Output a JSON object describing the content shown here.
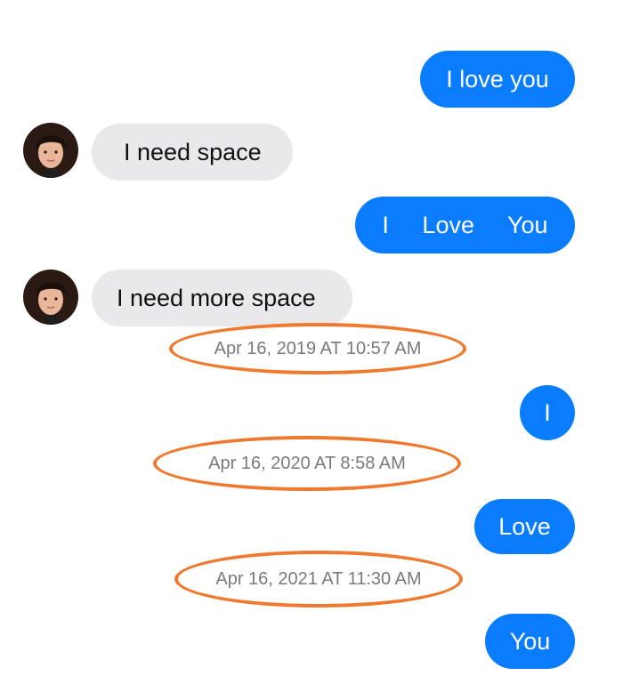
{
  "conversation": {
    "messages": [
      {
        "sender": "me",
        "text": "I love you"
      },
      {
        "sender": "contact",
        "text": "I need space"
      },
      {
        "sender": "me",
        "text": "I     Love     You"
      },
      {
        "sender": "contact",
        "text": "I need more space"
      },
      {
        "type": "timestamp",
        "text": "Apr 16, 2019 AT 10:57 AM"
      },
      {
        "sender": "me",
        "text": "I"
      },
      {
        "type": "timestamp",
        "text": "Apr 16, 2020 AT 8:58 AM"
      },
      {
        "sender": "me",
        "text": "Love"
      },
      {
        "type": "timestamp",
        "text": "Apr 16, 2021 AT 11:30 AM"
      },
      {
        "sender": "me",
        "text": "You"
      }
    ]
  },
  "colors": {
    "sent_bubble": "#0a7cff",
    "received_bubble": "#e9e9eb",
    "timestamp_text": "#7a7a7a",
    "highlight_ring": "#ef7a2f"
  },
  "icons": {
    "avatar": "contact-avatar-photo"
  }
}
